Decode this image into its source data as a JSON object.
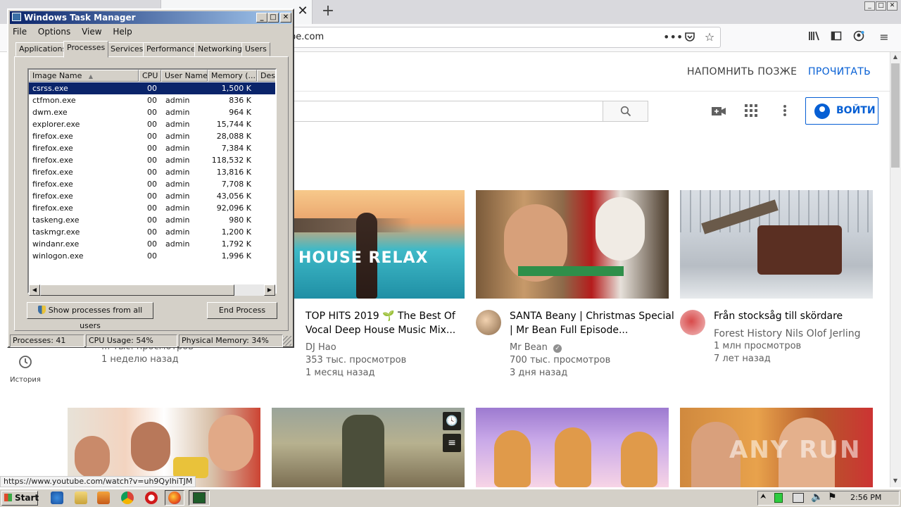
{
  "browser": {
    "url": "be.com",
    "tab_close": "✕",
    "new_tab": "+",
    "window_controls": [
      "_",
      "□",
      "✕"
    ],
    "toolbar_icons": [
      "more-icon",
      "pocket-icon",
      "bookmark-star-icon",
      "library-icon",
      "sidebar-icon",
      "account-icon",
      "menu-icon"
    ]
  },
  "youtube": {
    "banner": {
      "remind_later": "НАПОМНИТЬ ПОЗЖЕ",
      "read": "ПРОЧИТАТЬ"
    },
    "sign_in": "ВОЙТИ",
    "sidebar": {
      "history": "История"
    },
    "videos_row1": [
      {
        "title": "TOP HITS 2019 🌱 The Best Of Vocal Deep House Music Mix...",
        "channel": "DJ Hao",
        "views": "353 тыс. просмотров",
        "age": "1 месяц назад",
        "thumb_text": "HOUSE  RELAX"
      },
      {
        "title": "SANTA Beany | Christmas Special | Mr Bean Full Episode...",
        "channel": "Mr Bean",
        "views": "700 тыс. просмотров",
        "age": "3 дня назад"
      },
      {
        "title": "Från stocksåg till skördare",
        "channel": "Forest History Nils Olof Jerling",
        "views": "1 млн просмотров",
        "age": "7 лет назад"
      }
    ],
    "partial_video": {
      "views": "... тыс. просмотров",
      "age": "1 неделю назад"
    },
    "watermark": "ANY RUN"
  },
  "status_url": "https://www.youtube.com/watch?v=uh9QyIhiTJM",
  "task_manager": {
    "title": "Windows Task Manager",
    "menu": [
      "File",
      "Options",
      "View",
      "Help"
    ],
    "tabs": [
      "Applications",
      "Processes",
      "Services",
      "Performance",
      "Networking",
      "Users"
    ],
    "active_tab": "Processes",
    "columns": [
      "Image Name",
      "CPU",
      "User Name",
      "Memory (...",
      "Desc"
    ],
    "processes": [
      {
        "name": "csrss.exe",
        "cpu": "00",
        "user": "",
        "mem": "1,500 K"
      },
      {
        "name": "ctfmon.exe",
        "cpu": "00",
        "user": "admin",
        "mem": "836 K"
      },
      {
        "name": "dwm.exe",
        "cpu": "00",
        "user": "admin",
        "mem": "964 K"
      },
      {
        "name": "explorer.exe",
        "cpu": "00",
        "user": "admin",
        "mem": "15,744 K"
      },
      {
        "name": "firefox.exe",
        "cpu": "00",
        "user": "admin",
        "mem": "28,088 K"
      },
      {
        "name": "firefox.exe",
        "cpu": "00",
        "user": "admin",
        "mem": "7,384 K"
      },
      {
        "name": "firefox.exe",
        "cpu": "00",
        "user": "admin",
        "mem": "118,532 K"
      },
      {
        "name": "firefox.exe",
        "cpu": "00",
        "user": "admin",
        "mem": "13,816 K"
      },
      {
        "name": "firefox.exe",
        "cpu": "00",
        "user": "admin",
        "mem": "7,708 K"
      },
      {
        "name": "firefox.exe",
        "cpu": "00",
        "user": "admin",
        "mem": "43,056 K"
      },
      {
        "name": "firefox.exe",
        "cpu": "00",
        "user": "admin",
        "mem": "92,096 K"
      },
      {
        "name": "taskeng.exe",
        "cpu": "00",
        "user": "admin",
        "mem": "980 K"
      },
      {
        "name": "taskmgr.exe",
        "cpu": "00",
        "user": "admin",
        "mem": "1,200 K"
      },
      {
        "name": "windanr.exe",
        "cpu": "00",
        "user": "admin",
        "mem": "1,792 K"
      },
      {
        "name": "winlogon.exe",
        "cpu": "00",
        "user": "",
        "mem": "1,996 K"
      }
    ],
    "show_all_button": "Show processes from all users",
    "end_process_button": "End Process",
    "status": {
      "processes": "Processes: 41",
      "cpu": "CPU Usage: 54%",
      "memory": "Physical Memory: 34%"
    }
  },
  "taskbar": {
    "start": "Start",
    "clock": "2:56 PM"
  }
}
